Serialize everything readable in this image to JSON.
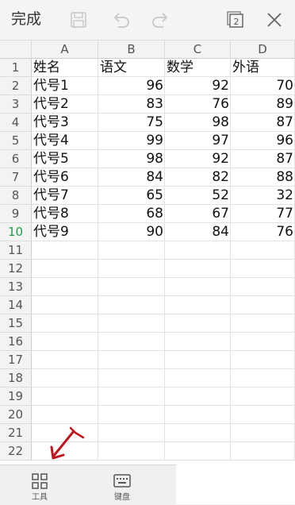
{
  "toolbar": {
    "done_label": "完成",
    "icons": [
      "save-icon",
      "undo-icon",
      "redo-icon",
      "switch-window-icon",
      "close-icon"
    ],
    "window_count": "2"
  },
  "sheet": {
    "columns": [
      "A",
      "B",
      "C",
      "D"
    ],
    "rows": [
      "1",
      "2",
      "3",
      "4",
      "5",
      "6",
      "7",
      "8",
      "9",
      "10",
      "11",
      "12",
      "13",
      "14",
      "15",
      "16",
      "17",
      "18",
      "19",
      "20",
      "21",
      "22"
    ],
    "active_row": "10",
    "data": [
      [
        "姓名",
        "语文",
        "数学",
        "外语"
      ],
      [
        "代号1",
        "96",
        "92",
        "70"
      ],
      [
        "代号2",
        "83",
        "76",
        "89"
      ],
      [
        "代号3",
        "75",
        "98",
        "87"
      ],
      [
        "代号4",
        "99",
        "97",
        "96"
      ],
      [
        "代号5",
        "98",
        "92",
        "87"
      ],
      [
        "代号6",
        "84",
        "82",
        "88"
      ],
      [
        "代号7",
        "65",
        "52",
        "32"
      ],
      [
        "代号8",
        "68",
        "67",
        "77"
      ],
      [
        "代号9",
        "90",
        "84",
        "76"
      ]
    ]
  },
  "bottombar": {
    "tools_label": "工具",
    "keyboard_label": "键盘"
  },
  "colors": {
    "active_row_number": "#1e9e4a",
    "annotation_arrow": "#c0161b"
  }
}
